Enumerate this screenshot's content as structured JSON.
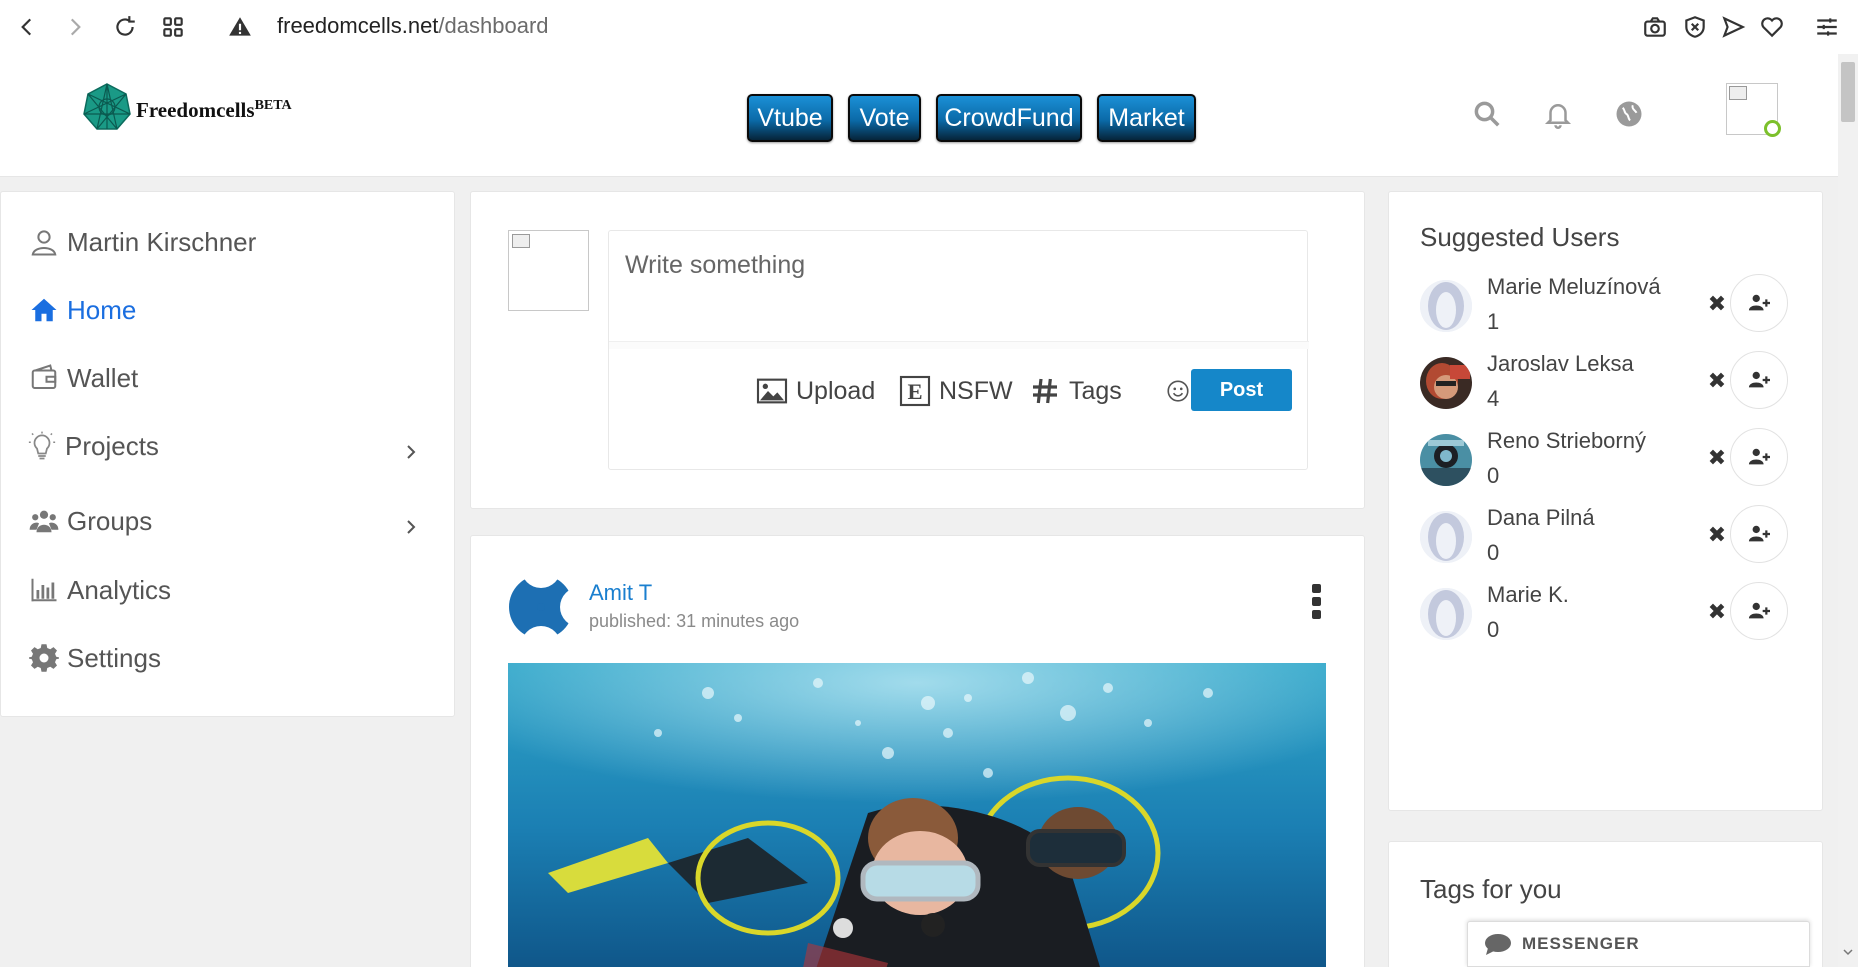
{
  "browser": {
    "url_domain": "freedomcells.net",
    "url_path": "/dashboard"
  },
  "header": {
    "logo_text": "Freedomcells",
    "logo_badge": "BETA",
    "nav": [
      {
        "label": "Vtube"
      },
      {
        "label": "Vote"
      },
      {
        "label": "CrowdFund"
      },
      {
        "label": "Market"
      }
    ],
    "icons": [
      "search-icon",
      "bell-icon",
      "globe-icon"
    ]
  },
  "sidebar": {
    "user_name": "Martin Kirschner",
    "items": [
      {
        "label": "Home",
        "icon": "home-icon",
        "active": true
      },
      {
        "label": "Wallet",
        "icon": "wallet-icon"
      },
      {
        "label": "Projects",
        "icon": "lightbulb-icon",
        "has_submenu": true
      },
      {
        "label": "Groups",
        "icon": "users-icon",
        "has_submenu": true
      },
      {
        "label": "Analytics",
        "icon": "bar-chart-icon"
      },
      {
        "label": "Settings",
        "icon": "gear-icon"
      }
    ]
  },
  "composer": {
    "placeholder": "Write something",
    "upload_label": "Upload",
    "nsfw_label": "NSFW",
    "tags_label": "Tags",
    "post_label": "Post"
  },
  "post": {
    "author": "Amit T",
    "published": "published: 31 minutes ago"
  },
  "suggested": {
    "title": "Suggested Users",
    "users": [
      {
        "name": "Marie Meluzínová",
        "count": "1"
      },
      {
        "name": "Jaroslav Leksa",
        "count": "4"
      },
      {
        "name": "Reno Strieborný",
        "count": "0"
      },
      {
        "name": "Dana Pilná",
        "count": "0"
      },
      {
        "name": "Marie K.",
        "count": "0"
      }
    ]
  },
  "tags": {
    "title": "Tags for you"
  },
  "messenger": {
    "label": "MESSENGER"
  },
  "colors": {
    "accent": "#1587c9",
    "link": "#1a7fcf",
    "active_nav": "#1a6ee0",
    "online": "#7cc02b"
  }
}
